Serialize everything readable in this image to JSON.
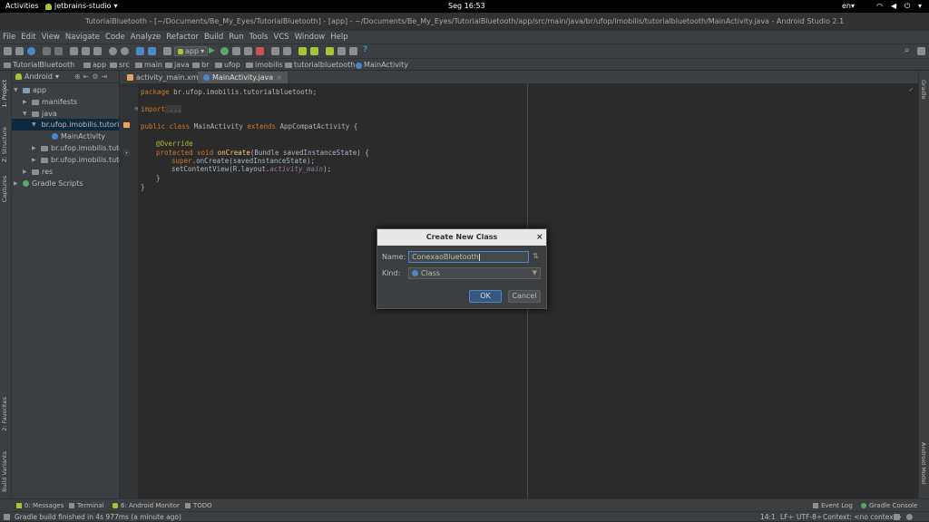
{
  "topbar": {
    "activities": "Activities",
    "app": "jetbrains-studio",
    "clock": "Seg 16:53",
    "lang": "en"
  },
  "window": {
    "title": "TutorialBluetooth - [~/Documents/Be_My_Eyes/TutorialBluetooth] - [app] - ~/Documents/Be_My_Eyes/TutorialBluetooth/app/src/main/java/br/ufop/imobilis/tutorialbluetooth/MainActivity.java - Android Studio 2.1"
  },
  "menu": [
    "File",
    "Edit",
    "View",
    "Navigate",
    "Code",
    "Analyze",
    "Refactor",
    "Build",
    "Run",
    "Tools",
    "VCS",
    "Window",
    "Help"
  ],
  "toolbar": {
    "run_config": "app"
  },
  "breadcrumb": [
    "TutorialBluetooth",
    "app",
    "src",
    "main",
    "java",
    "br",
    "ufop",
    "imobilis",
    "tutorialbluetooth",
    "MainActivity"
  ],
  "project": {
    "view": "Android",
    "tree": [
      "app",
      "manifests",
      "java",
      "br.ufop.imobilis.tutori",
      "MainActivity",
      "br.ufop.imobilis.tutori",
      "br.ufop.imobilis.tutori",
      "res",
      "Gradle Scripts"
    ]
  },
  "left_tabs": [
    "1: Project",
    "Z: Structure",
    "Captures",
    "2: Favorites",
    "Build Variants"
  ],
  "right_tabs": [
    "Gradle",
    "Android Model"
  ],
  "editor_tabs": [
    "activity_main.xml",
    "MainActivity.java"
  ],
  "code": {
    "l1a": "package",
    "l1b": " br.ufop.imobilis.tutorialbluetooth;",
    "l2a": "import",
    "l2b": " ...",
    "l3a": "public class",
    "l3b": " MainActivity ",
    "l3c": "extends",
    "l3d": " AppCompatActivity {",
    "l4": "@Override",
    "l5a": "protected void",
    "l5b": " onCreate",
    "l5c": "(Bundle savedInstanceState) {",
    "l6a": "super",
    "l6b": ".onCreate(savedInstanceState);",
    "l7a": "setContentView(R.layout.",
    "l7b": "activity_main",
    "l7c": ");",
    "l8": "}",
    "l9": "}"
  },
  "dialog": {
    "title": "Create New Class",
    "name_label": "Name:",
    "name_value": "ConexaoBluetooth",
    "kind_label": "Kind:",
    "kind_value": "Class",
    "ok": "OK",
    "cancel": "Cancel"
  },
  "bottom_tabs": [
    "0: Messages",
    "Terminal",
    "6: Android Monitor",
    "TODO",
    "Event Log",
    "Gradle Console"
  ],
  "status": {
    "message": "Gradle build finished in 4s 977ms (a minute ago)",
    "position": "14:1",
    "lf": "LF÷",
    "encoding": "UTF-8÷",
    "context": "Context: <no context>"
  },
  "colors": {
    "accent": "#4a88c7",
    "android_green": "#a4c639",
    "selection": "#0d293e"
  }
}
